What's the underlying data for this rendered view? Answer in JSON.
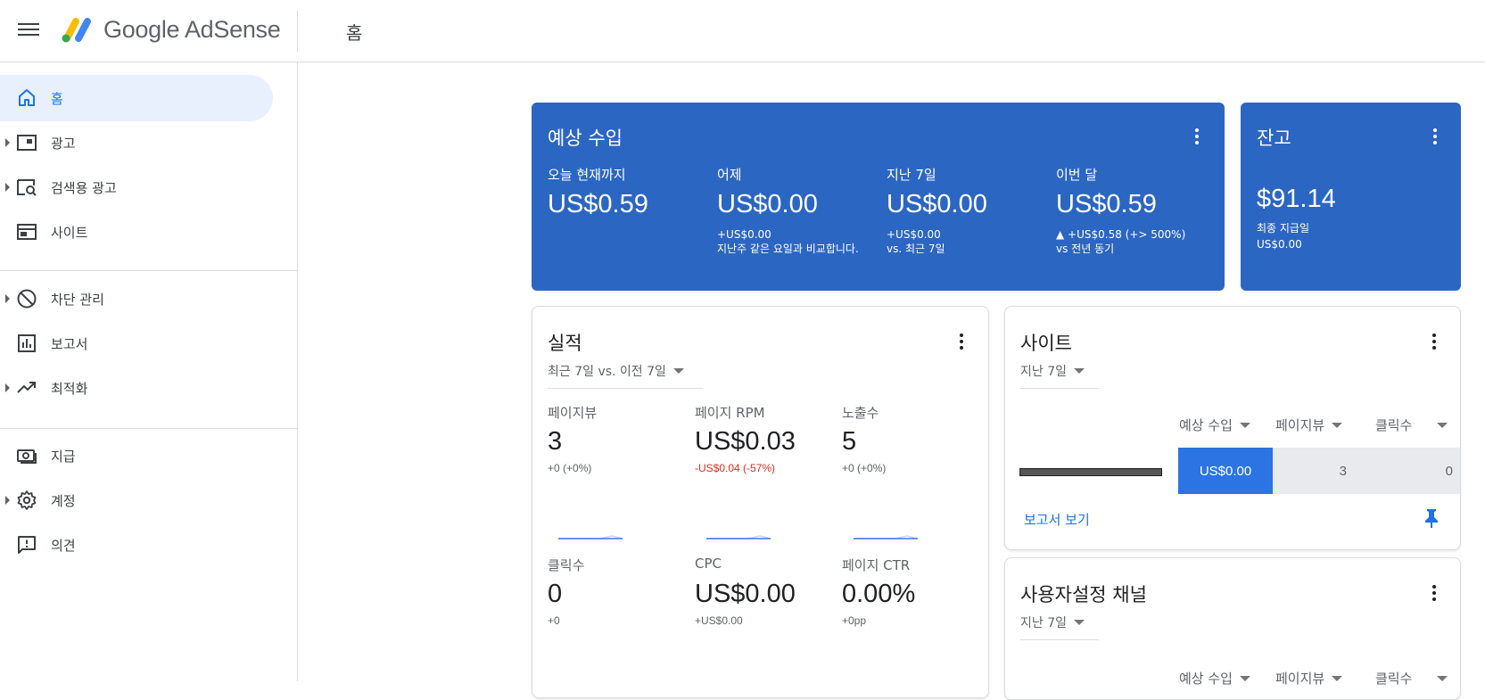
{
  "app": {
    "brand": "Google AdSense",
    "page_title": "홈"
  },
  "sidebar": {
    "items": [
      {
        "label": "홈",
        "icon": "home-icon",
        "active": true,
        "expandable": false
      },
      {
        "label": "광고",
        "icon": "ads-icon",
        "expandable": true
      },
      {
        "label": "검색용 광고",
        "icon": "search-ads-icon",
        "expandable": true
      },
      {
        "label": "사이트",
        "icon": "sites-icon",
        "expandable": false
      },
      {
        "label": "차단 관리",
        "icon": "block-icon",
        "expandable": true
      },
      {
        "label": "보고서",
        "icon": "reports-icon",
        "expandable": false
      },
      {
        "label": "최적화",
        "icon": "trending-icon",
        "expandable": true
      },
      {
        "label": "지급",
        "icon": "payments-icon",
        "expandable": false
      },
      {
        "label": "계정",
        "icon": "gear-icon",
        "expandable": true
      },
      {
        "label": "의견",
        "icon": "feedback-icon",
        "expandable": false
      }
    ]
  },
  "earnings": {
    "title": "예상 수입",
    "metrics": [
      {
        "label": "오늘 현재까지",
        "value": "US$0.59",
        "sub1": "",
        "sub2": ""
      },
      {
        "label": "어제",
        "value": "US$0.00",
        "sub1": "+US$0.00",
        "sub2": "지난주 같은 요일과 비교합니다."
      },
      {
        "label": "지난 7일",
        "value": "US$0.00",
        "sub1": "+US$0.00",
        "sub2": "vs. 최근 7일"
      },
      {
        "label": "이번 달",
        "value": "US$0.59",
        "sub1": "▲ +US$0.58 (+> 500%)",
        "sub2": "vs 전년 동기"
      }
    ]
  },
  "balance": {
    "title": "잔고",
    "value": "$91.14",
    "sub_label": "최종 지급일",
    "sub_value": "US$0.00"
  },
  "performance": {
    "title": "실적",
    "range": "최근 7일 vs. 이전 7일",
    "metrics": [
      {
        "label": "페이지뷰",
        "value": "3",
        "delta": "+0 (+0%)",
        "negative": false
      },
      {
        "label": "페이지 RPM",
        "value": "US$0.03",
        "delta": "-US$0.04 (-57%)",
        "negative": true
      },
      {
        "label": "노출수",
        "value": "5",
        "delta": "+0 (+0%)",
        "negative": false
      },
      {
        "label": "클릭수",
        "value": "0",
        "delta": "+0",
        "negative": false
      },
      {
        "label": "CPC",
        "value": "US$0.00",
        "delta": "+US$0.00",
        "negative": false
      },
      {
        "label": "페이지 CTR",
        "value": "0.00%",
        "delta": "+0pp",
        "negative": false
      }
    ],
    "colors": {
      "current": "#3b78e7",
      "previous": "#c6d7f3"
    }
  },
  "sites": {
    "title": "사이트",
    "range": "지난 7일",
    "columns": [
      "예상 수입",
      "페이지뷰",
      "클릭수"
    ],
    "row": {
      "earnings": "US$0.00",
      "pageviews": "3",
      "clicks": "0"
    },
    "report_link": "보고서 보기"
  },
  "custom_channels": {
    "title": "사용자설정 채널",
    "range": "지난 7일",
    "columns": [
      "예상 수입",
      "페이지뷰",
      "클릭수"
    ]
  },
  "colors": {
    "accent_blue": "#2c66c3",
    "link_blue": "#1a73e8",
    "active_bg": "#e8f0fe"
  }
}
